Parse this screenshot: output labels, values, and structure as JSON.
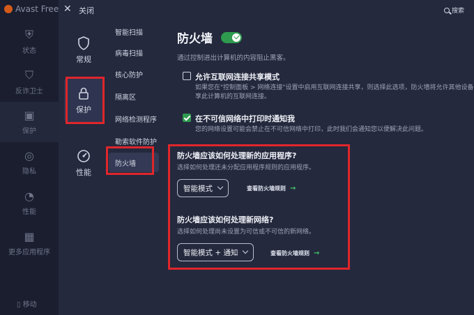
{
  "background": {
    "app_title": "Avast Free",
    "nav": [
      "状态",
      "反诈卫士",
      "保护",
      "隐私",
      "性能",
      "更多应用程序"
    ],
    "mobile_label": "移动"
  },
  "topbar": {
    "close_label": "关闭",
    "search_label": "搜索"
  },
  "categories": [
    {
      "label": "常规",
      "icon": "shield-icon"
    },
    {
      "label": "保护",
      "icon": "lock-icon",
      "active": true
    },
    {
      "label": "性能",
      "icon": "gauge-icon"
    }
  ],
  "subnav": [
    "智能扫描",
    "病毒扫描",
    "核心防护",
    "隔离区",
    "网络检测程序",
    "勒索软件防护",
    "防火墙"
  ],
  "content": {
    "title": "防火墙",
    "enabled": true,
    "description": "通过控制进出计算机的内容阻止黑客。",
    "options": [
      {
        "title": "允许互联网连接共享模式",
        "checked": false,
        "desc": "如果您在\"控制面板 > 网络连接\"设置中启用互联网连接共享，则选择此选项，防火墙将允许其他设备共享此计算机的互联网连接。"
      },
      {
        "title": "在不可信网络中打印时通知我",
        "checked": true,
        "desc": "您的网络设置可能会禁止在不可信网络中打印，此时我们会通知您以便解决此问题。"
      }
    ],
    "apps_section": {
      "title": "防火墙应该如何处理新的应用程序?",
      "desc": "选择如何处理还未分配应用程序规则的应用程序。",
      "select_value": "智能模式",
      "link": "查看防火墙规则"
    },
    "networks_section": {
      "title": "防火墙应该如何处理新网络?",
      "desc": "选择如何处理尚未设置为可信或不可信的新网络。",
      "select_value": "智能模式 + 通知",
      "link": "查看防火墙规则"
    }
  },
  "colors": {
    "accent_green": "#2e9b4f",
    "annotation_red": "#e0262b",
    "panel": "#24293d"
  }
}
